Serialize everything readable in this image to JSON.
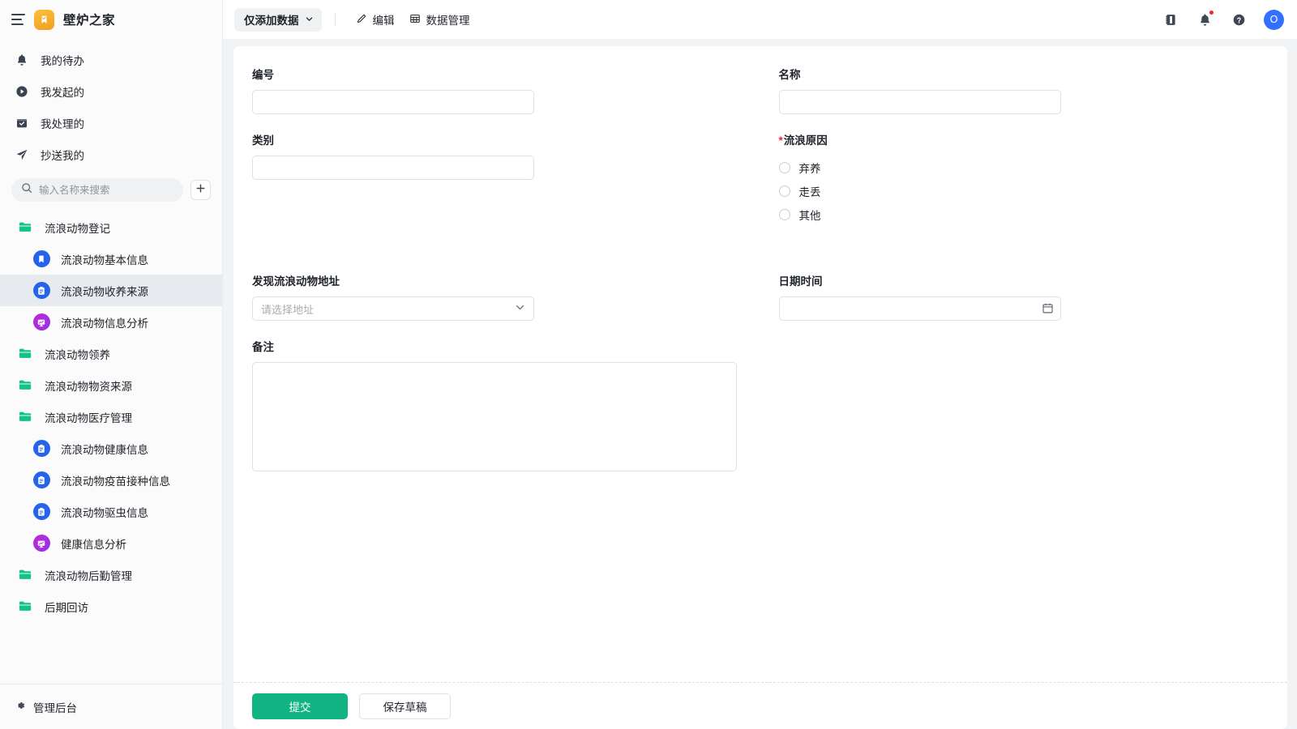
{
  "sidebar": {
    "brand": {
      "name": "壁炉之家",
      "logo_icon": "bookmark-logo-icon",
      "menu_icon": "hamburger-icon"
    },
    "nav": [
      {
        "label": "我的待办",
        "icon": "bell-icon"
      },
      {
        "label": "我发起的",
        "icon": "play-circle-icon"
      },
      {
        "label": "我处理的",
        "icon": "inbox-check-icon"
      },
      {
        "label": "抄送我的",
        "icon": "send-icon"
      }
    ],
    "search": {
      "placeholder": "输入名称来搜索",
      "value": "",
      "icon": "search-icon"
    },
    "add_button": {
      "icon": "plus-icon"
    },
    "tree": [
      {
        "label": "流浪动物登记",
        "level": 0,
        "icon": "folder-icon",
        "active": false
      },
      {
        "label": "流浪动物基本信息",
        "level": 1,
        "icon": "bookmark-circle-icon",
        "active": false
      },
      {
        "label": "流浪动物收养来源",
        "level": 1,
        "icon": "clipboard-circle-icon",
        "active": true
      },
      {
        "label": "流浪动物信息分析",
        "level": 1,
        "icon": "chart-circle-icon",
        "active": false
      },
      {
        "label": "流浪动物领养",
        "level": 0,
        "icon": "folder-icon",
        "active": false
      },
      {
        "label": "流浪动物物资来源",
        "level": 0,
        "icon": "folder-icon",
        "active": false
      },
      {
        "label": "流浪动物医疗管理",
        "level": 0,
        "icon": "folder-icon",
        "active": false
      },
      {
        "label": "流浪动物健康信息",
        "level": 1,
        "icon": "clipboard-circle-icon",
        "active": false
      },
      {
        "label": "流浪动物疫苗接种信息",
        "level": 1,
        "icon": "clipboard-circle-icon",
        "active": false
      },
      {
        "label": "流浪动物驱虫信息",
        "level": 1,
        "icon": "clipboard-circle-icon",
        "active": false
      },
      {
        "label": "健康信息分析",
        "level": 1,
        "icon": "chart-circle-icon",
        "active": false
      },
      {
        "label": "流浪动物后勤管理",
        "level": 0,
        "icon": "folder-icon",
        "active": false
      },
      {
        "label": "后期回访",
        "level": 0,
        "icon": "folder-icon",
        "active": false
      }
    ],
    "footer": {
      "label": "管理后台",
      "icon": "gear-icon"
    }
  },
  "topbar": {
    "mode_chip": {
      "label": "仅添加数据",
      "icon": "chevron-down-icon"
    },
    "edit_button": {
      "label": "编辑",
      "icon": "pencil-icon"
    },
    "data_manage_button": {
      "label": "数据管理",
      "icon": "table-icon"
    },
    "notebook_icon": "notebook-icon",
    "bell_icon": "bell-icon",
    "help_icon": "help-circle-icon",
    "avatar_initial": "O"
  },
  "form": {
    "fields": {
      "code": {
        "label": "编号",
        "value": "",
        "placeholder": ""
      },
      "name": {
        "label": "名称",
        "value": "",
        "placeholder": ""
      },
      "category": {
        "label": "类别",
        "value": "",
        "placeholder": ""
      },
      "reason": {
        "label": "流浪原因",
        "required": true,
        "required_mark": "*",
        "options": [
          {
            "label": "弃养",
            "selected": false
          },
          {
            "label": "走丢",
            "selected": false
          },
          {
            "label": "其他",
            "selected": false
          }
        ]
      },
      "address": {
        "label": "发现流浪动物地址",
        "value": "",
        "placeholder": "请选择地址",
        "icon": "chevron-down-icon"
      },
      "datetime": {
        "label": "日期时间",
        "value": "",
        "placeholder": "",
        "icon": "calendar-icon"
      },
      "remark": {
        "label": "备注",
        "value": "",
        "placeholder": ""
      }
    }
  },
  "footer": {
    "submit_label": "提交",
    "draft_label": "保存草稿"
  },
  "colors": {
    "primary_green": "#11b383",
    "brand_orange": "#f0a01e",
    "accent_blue": "#2563eb",
    "avatar_blue": "#3370ff",
    "required_red": "#f5222d",
    "folder_green": "#13c28a"
  }
}
